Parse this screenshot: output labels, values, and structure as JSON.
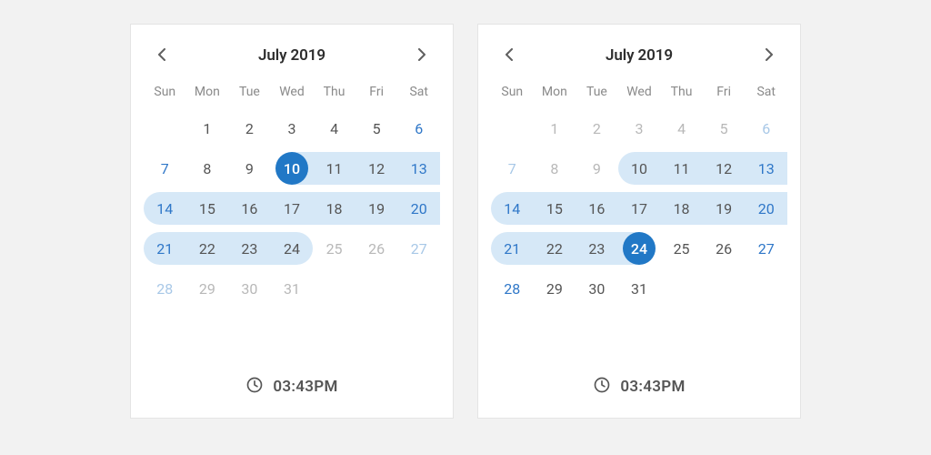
{
  "panels": [
    {
      "title": "July 2019",
      "time": "03:43PM",
      "dow": [
        "Sun",
        "Mon",
        "Tue",
        "Wed",
        "Thu",
        "Fri",
        "Sat"
      ],
      "weeks": [
        [
          {
            "n": "",
            "cls": "empty"
          },
          {
            "n": "1",
            "cls": ""
          },
          {
            "n": "2",
            "cls": ""
          },
          {
            "n": "3",
            "cls": ""
          },
          {
            "n": "4",
            "cls": ""
          },
          {
            "n": "5",
            "cls": ""
          },
          {
            "n": "6",
            "cls": "weekend"
          }
        ],
        [
          {
            "n": "7",
            "cls": "weekend"
          },
          {
            "n": "8",
            "cls": ""
          },
          {
            "n": "9",
            "cls": ""
          },
          {
            "n": "10",
            "cls": "selected",
            "bg": "right"
          },
          {
            "n": "11",
            "cls": "inrange",
            "bg": "mid"
          },
          {
            "n": "12",
            "cls": "inrange",
            "bg": "mid"
          },
          {
            "n": "13",
            "cls": "weekend inrange",
            "bg": "mid"
          }
        ],
        [
          {
            "n": "14",
            "cls": "weekend inrange range-startcap",
            "bg": "mid"
          },
          {
            "n": "15",
            "cls": "inrange",
            "bg": "mid"
          },
          {
            "n": "16",
            "cls": "inrange",
            "bg": "mid"
          },
          {
            "n": "17",
            "cls": "inrange",
            "bg": "mid"
          },
          {
            "n": "18",
            "cls": "inrange",
            "bg": "mid"
          },
          {
            "n": "19",
            "cls": "inrange",
            "bg": "mid"
          },
          {
            "n": "20",
            "cls": "weekend inrange",
            "bg": "mid"
          }
        ],
        [
          {
            "n": "21",
            "cls": "weekend inrange range-startcap",
            "bg": "mid"
          },
          {
            "n": "22",
            "cls": "inrange",
            "bg": "mid"
          },
          {
            "n": "23",
            "cls": "inrange",
            "bg": "mid"
          },
          {
            "n": "24",
            "cls": "inrange range-endcap",
            "bg": "mid"
          },
          {
            "n": "25",
            "cls": "muted"
          },
          {
            "n": "26",
            "cls": "muted"
          },
          {
            "n": "27",
            "cls": "muted weekend"
          }
        ],
        [
          {
            "n": "28",
            "cls": "muted weekend"
          },
          {
            "n": "29",
            "cls": "muted"
          },
          {
            "n": "30",
            "cls": "muted"
          },
          {
            "n": "31",
            "cls": "muted"
          },
          {
            "n": "",
            "cls": "empty"
          },
          {
            "n": "",
            "cls": "empty"
          },
          {
            "n": "",
            "cls": "empty"
          }
        ]
      ]
    },
    {
      "title": "July 2019",
      "time": "03:43PM",
      "dow": [
        "Sun",
        "Mon",
        "Tue",
        "Wed",
        "Thu",
        "Fri",
        "Sat"
      ],
      "weeks": [
        [
          {
            "n": "",
            "cls": "empty"
          },
          {
            "n": "1",
            "cls": "muted"
          },
          {
            "n": "2",
            "cls": "muted"
          },
          {
            "n": "3",
            "cls": "muted"
          },
          {
            "n": "4",
            "cls": "muted"
          },
          {
            "n": "5",
            "cls": "muted"
          },
          {
            "n": "6",
            "cls": "muted weekend"
          }
        ],
        [
          {
            "n": "7",
            "cls": "muted weekend"
          },
          {
            "n": "8",
            "cls": "muted"
          },
          {
            "n": "9",
            "cls": "muted"
          },
          {
            "n": "10",
            "cls": "inrange range-startcap",
            "bg": "mid"
          },
          {
            "n": "11",
            "cls": "inrange",
            "bg": "mid"
          },
          {
            "n": "12",
            "cls": "inrange",
            "bg": "mid"
          },
          {
            "n": "13",
            "cls": "weekend inrange",
            "bg": "mid"
          }
        ],
        [
          {
            "n": "14",
            "cls": "weekend inrange range-startcap",
            "bg": "mid"
          },
          {
            "n": "15",
            "cls": "inrange",
            "bg": "mid"
          },
          {
            "n": "16",
            "cls": "inrange",
            "bg": "mid"
          },
          {
            "n": "17",
            "cls": "inrange",
            "bg": "mid"
          },
          {
            "n": "18",
            "cls": "inrange",
            "bg": "mid"
          },
          {
            "n": "19",
            "cls": "inrange",
            "bg": "mid"
          },
          {
            "n": "20",
            "cls": "weekend inrange",
            "bg": "mid"
          }
        ],
        [
          {
            "n": "21",
            "cls": "weekend inrange range-startcap",
            "bg": "mid"
          },
          {
            "n": "22",
            "cls": "inrange",
            "bg": "mid"
          },
          {
            "n": "23",
            "cls": "inrange",
            "bg": "mid"
          },
          {
            "n": "24",
            "cls": "selected",
            "bg": "left"
          },
          {
            "n": "25",
            "cls": ""
          },
          {
            "n": "26",
            "cls": ""
          },
          {
            "n": "27",
            "cls": "weekend"
          }
        ],
        [
          {
            "n": "28",
            "cls": "weekend"
          },
          {
            "n": "29",
            "cls": ""
          },
          {
            "n": "30",
            "cls": ""
          },
          {
            "n": "31",
            "cls": ""
          },
          {
            "n": "",
            "cls": "empty"
          },
          {
            "n": "",
            "cls": "empty"
          },
          {
            "n": "",
            "cls": "empty"
          }
        ]
      ]
    }
  ]
}
